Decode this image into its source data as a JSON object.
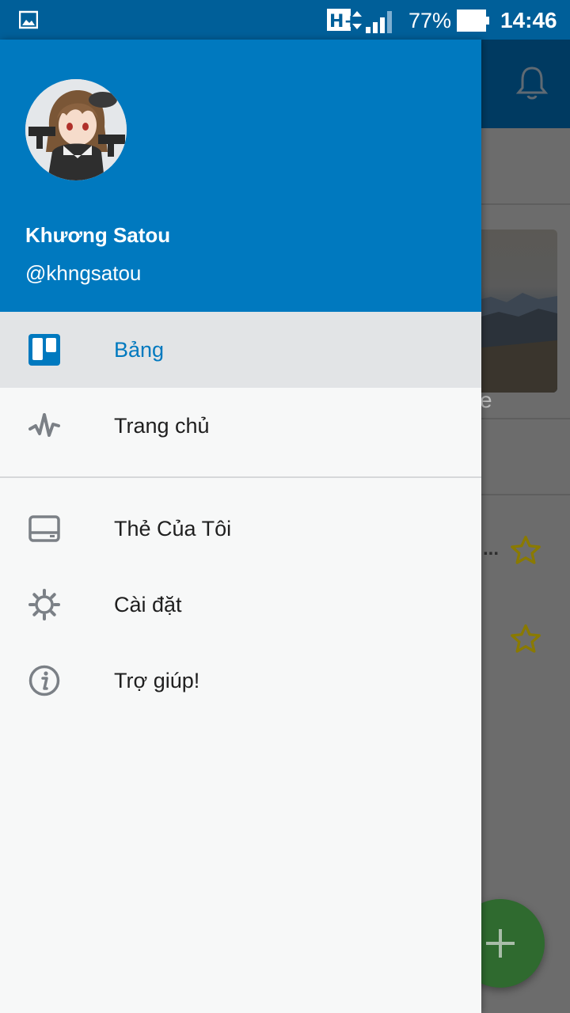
{
  "status_bar": {
    "network": "H+",
    "battery_percent": "77%",
    "time": "14:46",
    "icons": [
      "gallery-icon",
      "network-hplus-icon",
      "signal-icon",
      "battery-icon"
    ]
  },
  "background": {
    "photo_caption_fragment": "e",
    "ellipsis": "...",
    "icons": [
      "bell-icon",
      "star-outline-icon",
      "star-outline-icon",
      "plus-icon"
    ],
    "colors": {
      "toolbar": "#003a61",
      "fab": "#2f6a2f",
      "star": "#8a7a00"
    }
  },
  "drawer": {
    "user": {
      "name": "Khương Satou",
      "handle": "@khngsatou",
      "avatar_icon": "avatar-anime-girl"
    },
    "nav": [
      {
        "label": "Bảng",
        "icon": "boards-icon",
        "active": true
      },
      {
        "label": "Trang chủ",
        "icon": "activity-icon",
        "active": false
      }
    ],
    "secondary_nav": [
      {
        "label": "Thẻ Của Tôi",
        "icon": "cards-icon"
      },
      {
        "label": "Cài đặt",
        "icon": "gear-icon"
      },
      {
        "label": "Trợ giúp!",
        "icon": "info-icon"
      }
    ],
    "colors": {
      "header": "#0079bf",
      "active_bg": "#e2e4e6",
      "active_text": "#0079bf",
      "icon_gray": "#7b8086"
    }
  }
}
